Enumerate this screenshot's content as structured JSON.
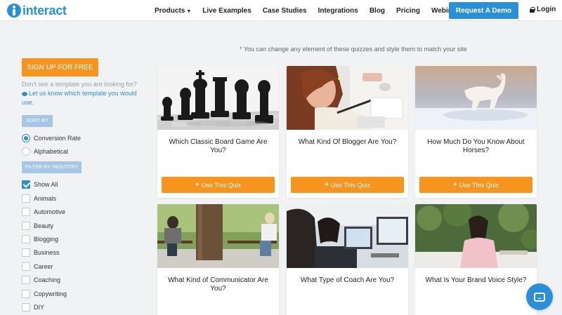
{
  "header": {
    "logo_text": "interact",
    "nav": [
      {
        "label": "Products",
        "has_caret": true
      },
      {
        "label": "Live Examples"
      },
      {
        "label": "Case Studies"
      },
      {
        "label": "Integrations"
      },
      {
        "label": "Blog"
      },
      {
        "label": "Pricing"
      },
      {
        "label": "Webinar"
      }
    ],
    "demo_button": "Request A Demo",
    "login": "Login"
  },
  "sidebar": {
    "signup_button": "SIGN UP FOR FREE",
    "hint_text": "Don't see a template you are looking for?",
    "hint_link": "Let us know which template you would use.",
    "sort_by": "SORT BY",
    "sort_options": [
      {
        "label": "Conversion Rate",
        "selected": true
      },
      {
        "label": "Alphabetical",
        "selected": false
      }
    ],
    "filter_by": "FILTER BY INDUSTRY",
    "industries": [
      {
        "label": "Show All",
        "checked": true
      },
      {
        "label": "Animals",
        "checked": false
      },
      {
        "label": "Automotive",
        "checked": false
      },
      {
        "label": "Beauty",
        "checked": false
      },
      {
        "label": "Blogging",
        "checked": false
      },
      {
        "label": "Business",
        "checked": false
      },
      {
        "label": "Career",
        "checked": false
      },
      {
        "label": "Coaching",
        "checked": false
      },
      {
        "label": "Copywriting",
        "checked": false
      },
      {
        "label": "DIY",
        "checked": false
      }
    ]
  },
  "main": {
    "note": "* You can change any element of these quizzes and style them to match your site",
    "use_quiz_label": "Use This Quiz",
    "cards": [
      {
        "title": "Which Classic Board Game Are You?",
        "image": "chess-pieces-photo",
        "has_button": true
      },
      {
        "title": "What Kind Of Blogger Are You?",
        "image": "woman-writing-photo",
        "has_button": true
      },
      {
        "title": "How Much Do You Know About Horses?",
        "image": "horse-in-snow-photo",
        "has_button": true
      },
      {
        "title": "What Kind of Communicator Are You?",
        "image": "women-on-bench-photo",
        "has_button": false
      },
      {
        "title": "What Type of Coach Are You?",
        "image": "women-at-computer-photo",
        "has_button": false
      },
      {
        "title": "What Is Your Brand Voice Style?",
        "image": "woman-on-phone-photo",
        "has_button": false
      }
    ]
  },
  "colors": {
    "brand_blue": "#2a8fd6",
    "accent_orange": "#f7941d",
    "tag_blue": "#a7c6e6",
    "page_bg": "#f1f2f4"
  }
}
